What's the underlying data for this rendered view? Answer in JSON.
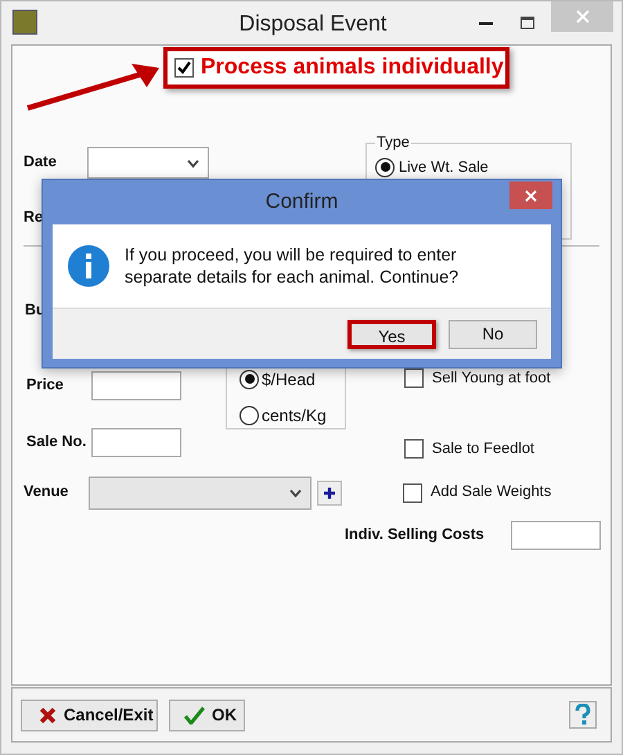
{
  "window": {
    "title": "Disposal Event"
  },
  "annotation": {
    "label": "Process animals individually",
    "checked": true
  },
  "date": {
    "label": "Date"
  },
  "type_group": {
    "title": "Type",
    "options": [
      {
        "label": "Live Wt. Sale",
        "selected": true
      }
    ]
  },
  "covered_labels": [
    "Re",
    "Bu"
  ],
  "price": {
    "label": "Price"
  },
  "sale_no": {
    "label": "Sale No."
  },
  "price_unit": [
    {
      "label": "$/Head",
      "selected": true
    },
    {
      "label": "cents/Kg",
      "selected": false
    }
  ],
  "options": [
    {
      "label": "Sell Young at foot",
      "checked": false
    },
    {
      "label": "Sale to Feedlot",
      "checked": false
    },
    {
      "label": "Add Sale Weights",
      "checked": false
    }
  ],
  "venue": {
    "label": "Venue"
  },
  "indiv_selling_costs": {
    "label": "Indiv. Selling Costs"
  },
  "buttons": [
    {
      "label": "Cancel/Exit",
      "kind": "cancel"
    },
    {
      "label": "OK",
      "kind": "ok"
    }
  ],
  "dialog": {
    "title": "Confirm",
    "message": "If you proceed, you will be required to enter separate details for each animal. Continue?",
    "buttons": [
      {
        "label": "Yes",
        "highlighted": true
      },
      {
        "label": "No",
        "highlighted": false
      }
    ]
  }
}
